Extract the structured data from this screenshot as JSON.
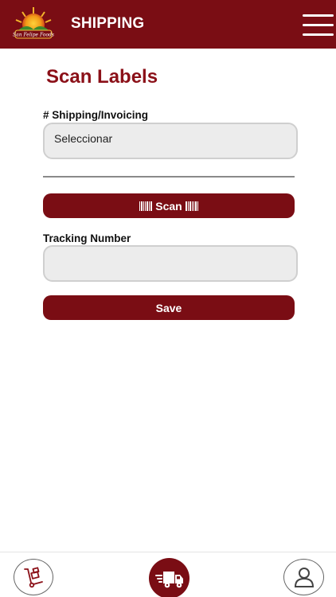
{
  "header": {
    "title": "SHIPPING",
    "logo_text": "San Felipe Foods",
    "brand_color": "#7a0d14"
  },
  "main": {
    "title": "Scan Labels",
    "shipping_field": {
      "label": "# Shipping/Invoicing",
      "value": "Seleccionar"
    },
    "scan_button_label": "Scan",
    "tracking_field": {
      "label": "Tracking Number",
      "value": ""
    },
    "save_button_label": "Save"
  },
  "bottom_nav": {
    "items": [
      {
        "icon": "hand-truck-icon",
        "active": false
      },
      {
        "icon": "delivery-truck-icon",
        "active": true
      },
      {
        "icon": "user-icon",
        "active": false
      }
    ]
  }
}
